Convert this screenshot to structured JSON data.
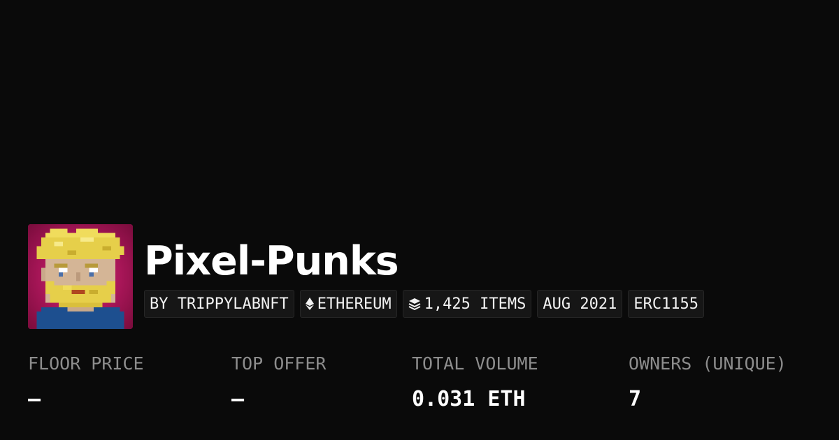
{
  "collection": {
    "name": "Pixel-Punks",
    "avatar_icon": "pixel-punk-avatar"
  },
  "tags": {
    "creator": "BY TRIPPYLABNFT",
    "chain": "ETHEREUM",
    "chain_icon": "ethereum-icon",
    "items": "1,425 ITEMS",
    "items_icon": "layers-icon",
    "date": "AUG 2021",
    "standard": "ERC1155"
  },
  "stats": {
    "floor_price": {
      "label": "FLOOR PRICE",
      "value": "–"
    },
    "top_offer": {
      "label": "TOP OFFER",
      "value": "–"
    },
    "total_volume": {
      "label": "TOTAL VOLUME",
      "value": "0.031 ETH"
    },
    "owners": {
      "label": "OWNERS (UNIQUE)",
      "value": "7"
    }
  },
  "colors": {
    "background": "#0a0a0a",
    "tag_background": "#161616",
    "label_gray": "#8d8d8d",
    "avatar_background": "#d11a6b"
  }
}
